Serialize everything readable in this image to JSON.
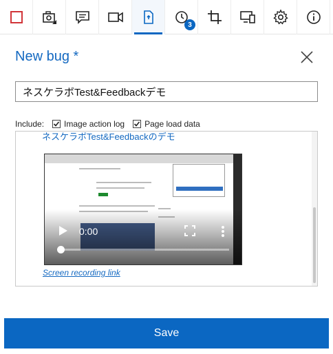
{
  "toolbar": {
    "buttons": [
      {
        "name": "stop",
        "icon": "stop-square-icon"
      },
      {
        "name": "screenshot",
        "icon": "camera-capture-icon"
      },
      {
        "name": "note",
        "icon": "note-icon"
      },
      {
        "name": "video",
        "icon": "video-camera-icon"
      },
      {
        "name": "bug",
        "icon": "bug-report-icon",
        "active": true
      },
      {
        "name": "timeline",
        "icon": "history-clock-icon"
      },
      {
        "name": "crop",
        "icon": "crop-icon"
      },
      {
        "name": "devices",
        "icon": "device-icon"
      },
      {
        "name": "settings",
        "icon": "gear-icon"
      },
      {
        "name": "info",
        "icon": "info-icon"
      }
    ],
    "timeline_badge": "3"
  },
  "form": {
    "title": "New bug *",
    "bug_title_value": "ネスケラボTest&Feedbackデモ",
    "include_label": "Include:",
    "include_options": [
      {
        "label": "Image action log",
        "checked": true
      },
      {
        "label": "Page load data",
        "checked": true
      }
    ]
  },
  "preview": {
    "heading": "ネスケラボTest&Feedbackのデモ",
    "video_time": "0:00",
    "video_progress": 0,
    "recording_link": "Screen recording link"
  },
  "save_label": "Save",
  "colors": {
    "accent": "#0b67c2",
    "stop_red": "#d13438"
  }
}
